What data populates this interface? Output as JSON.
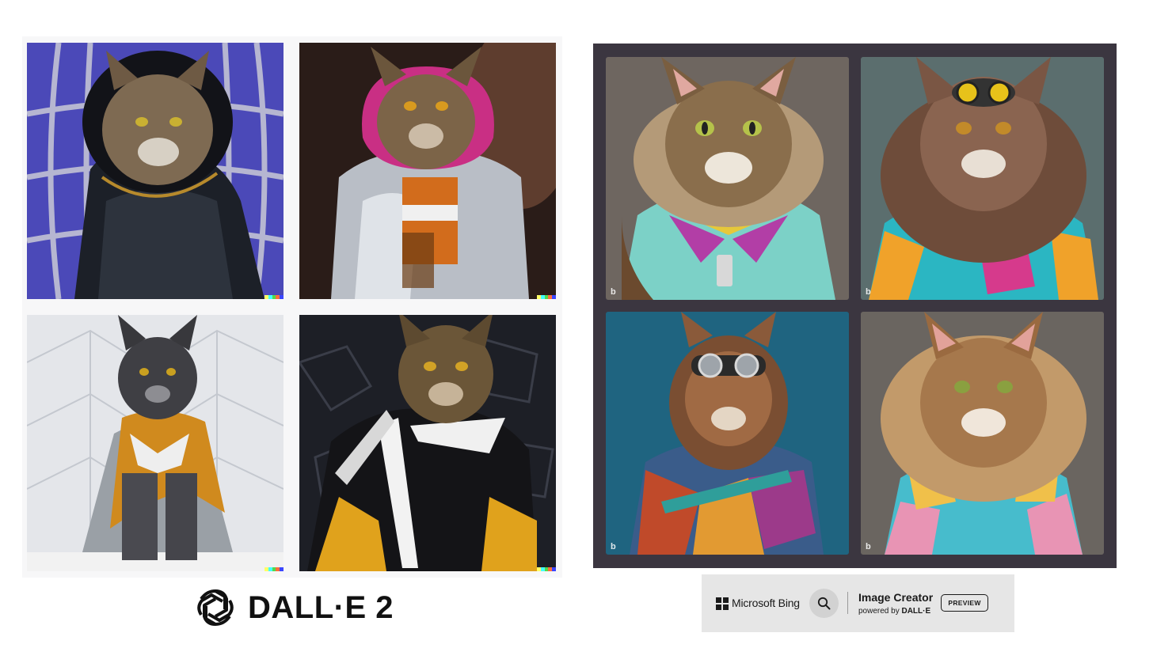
{
  "left_panel": {
    "tiles": [
      {
        "label": "cat in black leather hooded jacket, purple grid background"
      },
      {
        "label": "cat in silver jacket with pink hood, dark background"
      },
      {
        "label": "grey cat in orange leather jacket, white geometric background"
      },
      {
        "label": "cat in black white and orange jacket, dark stone background"
      }
    ],
    "watermark_colors": [
      "#ffff66",
      "#42ffff",
      "#51da4c",
      "#ff6e3c",
      "#3c46ff"
    ]
  },
  "dalle_brand": {
    "logo_icon": "openai-logo-icon",
    "name": "DALL·E 2"
  },
  "right_panel": {
    "tiles": [
      {
        "label": "maine coon in teal jacket with colorful collar"
      },
      {
        "label": "long-haired cat with goggles in colorful jacket"
      },
      {
        "label": "cat with steampunk goggles in patchwork jacket, blue background"
      },
      {
        "label": "fluffy maine coon in pastel jacket"
      }
    ],
    "tile_mark": "b"
  },
  "bing_bar": {
    "brand": "Microsoft Bing",
    "search_icon": "search-icon",
    "title": "Image Creator",
    "subtitle_prefix": "powered by ",
    "subtitle_brand": "DALL·E",
    "badge": "PREVIEW"
  }
}
